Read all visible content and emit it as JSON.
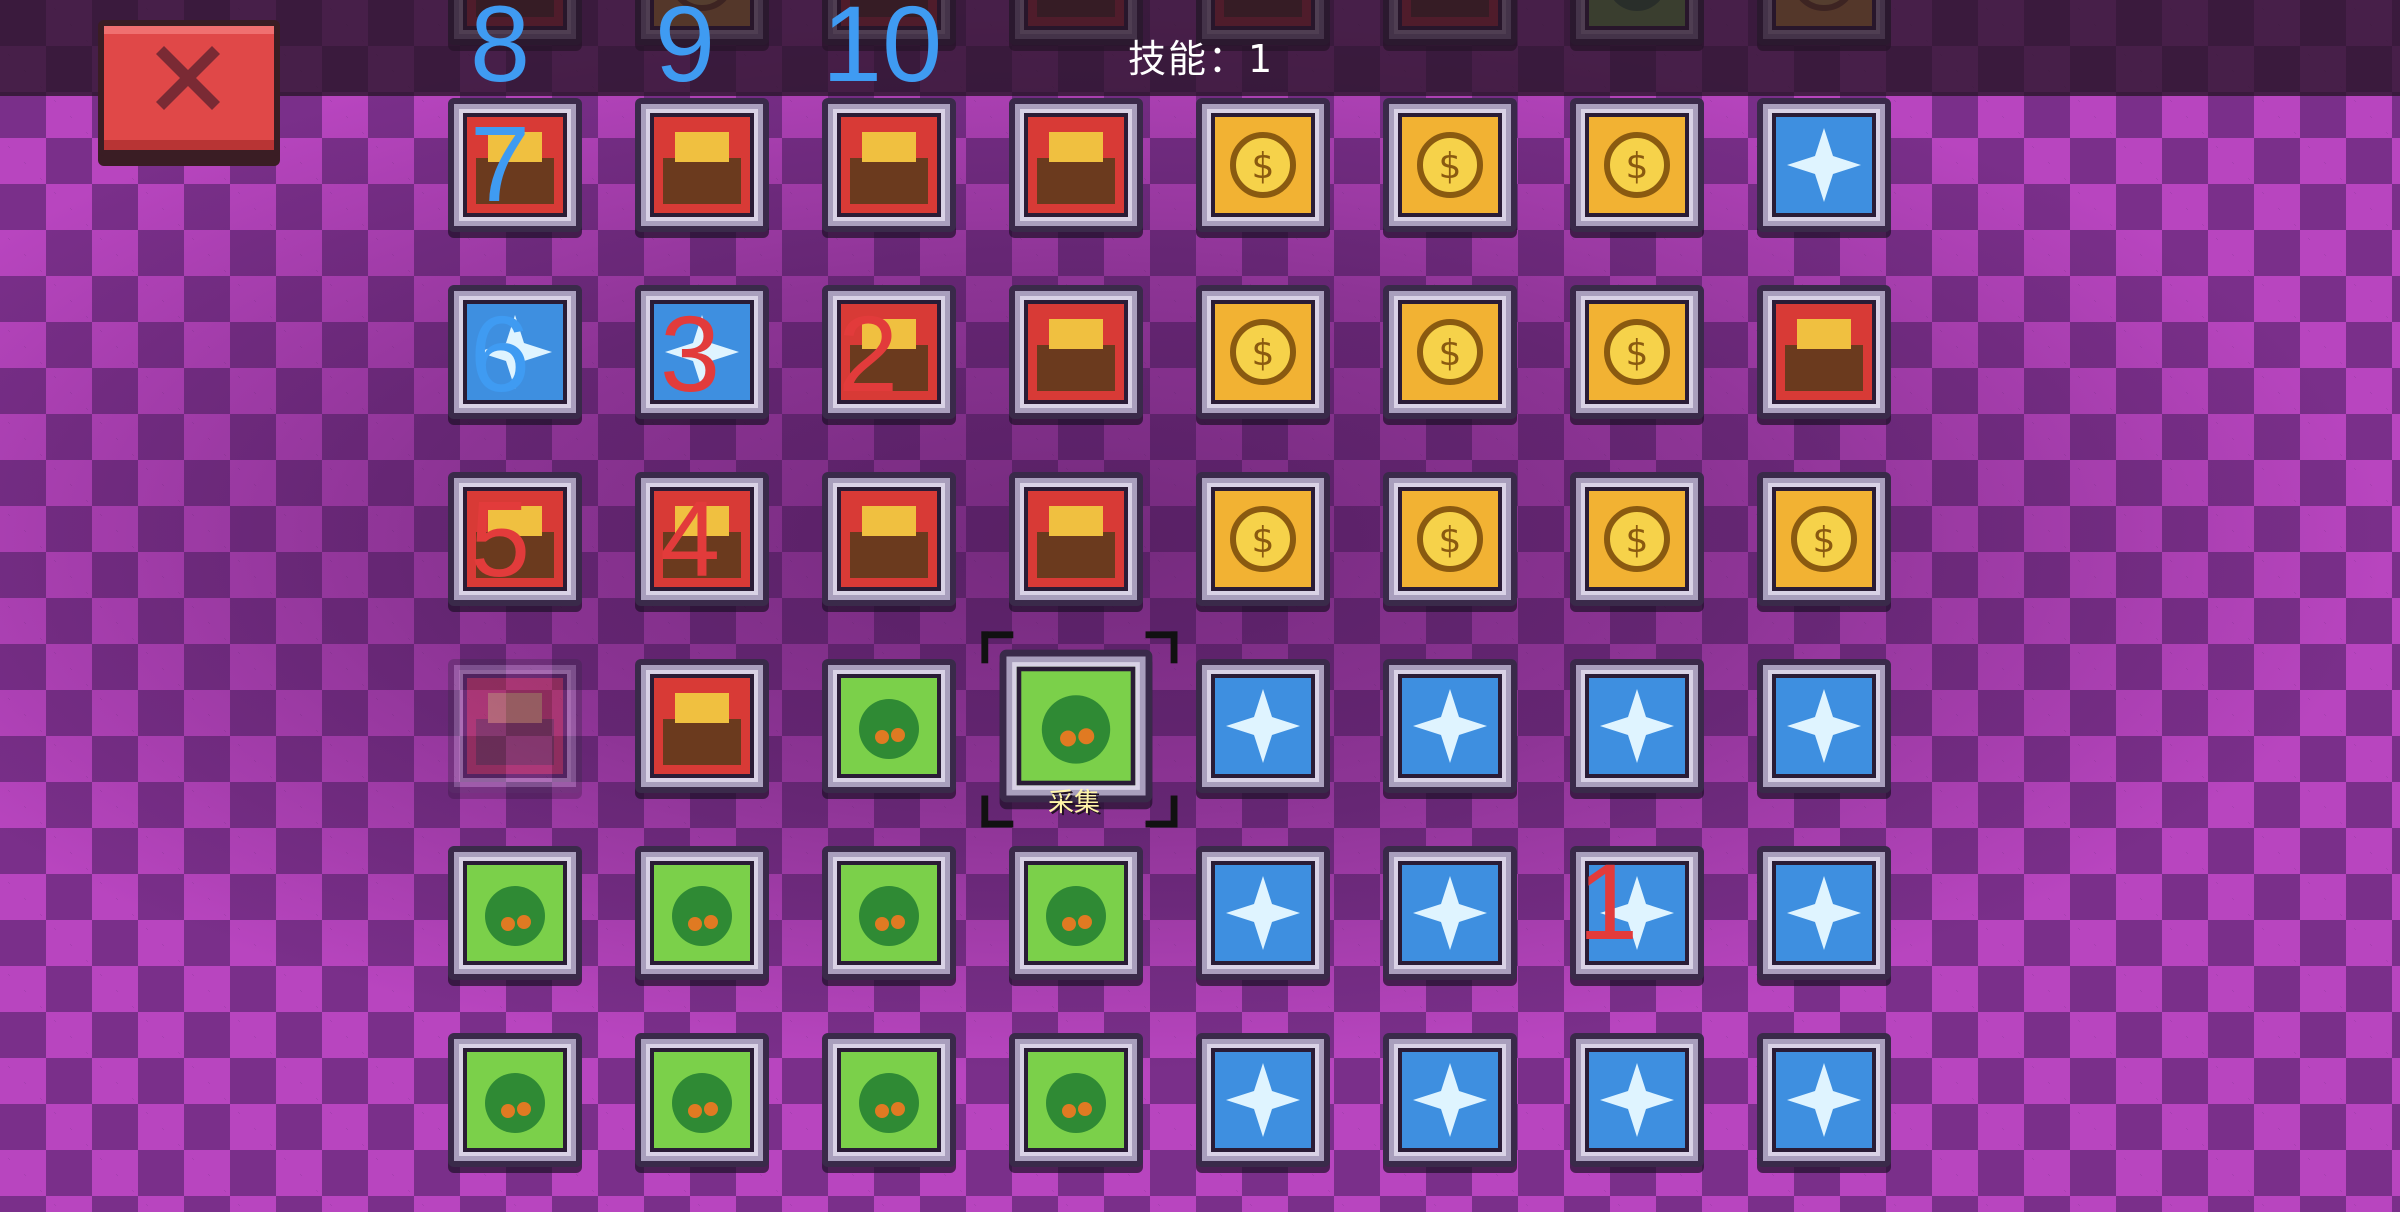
{
  "header": {
    "skill_counter": "技能：1"
  },
  "close_button": {
    "icon": "close-x-icon",
    "color": "#e04848"
  },
  "selected_tile": {
    "caption": "采集",
    "icon": "gathering-berry-bush-icon"
  },
  "tile_backgrounds": {
    "red": "#d83a36",
    "yellow": "#f2b233",
    "green": "#7bd04a",
    "blue": "#3e8fe0"
  },
  "tiles": [
    {
      "icon": "fireball-icon",
      "bg": "red"
    },
    {
      "icon": "locomotive-icon",
      "bg": "red"
    },
    {
      "icon": "molten-metal-icon",
      "bg": "red"
    },
    {
      "icon": "cloth-scissors-icon",
      "bg": "red"
    },
    {
      "icon": "money-plant-icon",
      "bg": "yellow"
    },
    {
      "icon": "hand-coins-icon",
      "bg": "yellow"
    },
    {
      "icon": "bank-icon",
      "bg": "yellow"
    },
    {
      "icon": "magic-brick-wall-icon",
      "bg": "blue"
    },
    {
      "icon": "flooded-house-icon",
      "bg": "blue"
    },
    {
      "icon": "factory-smoke-icon",
      "bg": "blue"
    },
    {
      "icon": "anvil-icon",
      "bg": "red"
    },
    {
      "icon": "yarn-scissors-icon",
      "bg": "red"
    },
    {
      "icon": "market-stall-icon",
      "bg": "yellow"
    },
    {
      "icon": "piggy-bank-icon",
      "bg": "yellow"
    },
    {
      "icon": "ghost-hand-icon",
      "bg": "yellow"
    },
    {
      "icon": "brick-wall-icon",
      "bg": "red"
    },
    {
      "icon": "claw-grabber-icon",
      "bg": "red"
    },
    {
      "icon": "stone-hammer-icon",
      "bg": "red"
    },
    {
      "icon": "wood-saw-icon",
      "bg": "red"
    },
    {
      "icon": "kiln-furnace-icon",
      "bg": "red"
    },
    {
      "icon": "coin-stacks-icon",
      "bg": "yellow"
    },
    {
      "icon": "vault-safe-icon",
      "bg": "yellow"
    },
    {
      "icon": "slot-machine-icon",
      "bg": "yellow"
    },
    {
      "icon": "magic-orb-icon",
      "bg": "yellow"
    },
    {
      "icon": "spotted-egg-icon",
      "bg": "red",
      "dim": true
    },
    {
      "icon": "barn-wheat-icon",
      "bg": "red"
    },
    {
      "icon": "root-vegetable-icon",
      "bg": "green"
    },
    {
      "icon": "gathering-berry-bush-icon",
      "bg": "green",
      "selected": true
    },
    {
      "icon": "lightbulb-brain-icon",
      "bg": "blue"
    },
    {
      "icon": "cauldron-icon",
      "bg": "blue"
    },
    {
      "icon": "scroll-map-icon",
      "bg": "blue"
    },
    {
      "icon": "potion-bottle-icon",
      "bg": "blue"
    },
    {
      "icon": "stone-ore-icon",
      "bg": "green"
    },
    {
      "icon": "pickaxe-rocks-icon",
      "bg": "green"
    },
    {
      "icon": "koi-fish-icon",
      "bg": "green"
    },
    {
      "icon": "bow-arrow-icon",
      "bg": "green"
    },
    {
      "icon": "sword-shield-icon",
      "bg": "blue"
    },
    {
      "icon": "turtle-ghost-icon",
      "bg": "blue"
    },
    {
      "icon": "spell-book-icon",
      "bg": "blue"
    },
    {
      "icon": "sparkle-hands-icon",
      "bg": "blue"
    }
  ],
  "overlay_numbers": [
    {
      "text": "8",
      "color": "blue"
    },
    {
      "text": "9",
      "color": "blue"
    },
    {
      "text": "10",
      "color": "blue"
    },
    {
      "text": "7",
      "color": "blue"
    },
    {
      "text": "6",
      "color": "blue"
    },
    {
      "text": "3",
      "color": "red"
    },
    {
      "text": "2",
      "color": "red"
    },
    {
      "text": "5",
      "color": "red"
    },
    {
      "text": "4",
      "color": "red"
    },
    {
      "text": "1",
      "color": "red"
    }
  ]
}
